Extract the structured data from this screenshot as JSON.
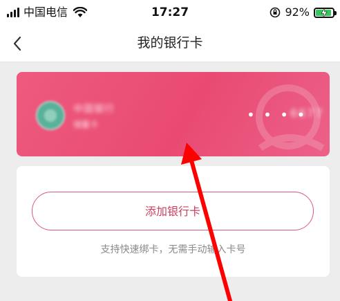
{
  "status_bar": {
    "carrier": "中国电信",
    "time": "17:27",
    "battery_percent": "92%",
    "battery_level": 0.92,
    "icons": [
      "signal-icon",
      "wifi-icon",
      "rotation-lock-icon",
      "battery-charging-icon"
    ]
  },
  "nav": {
    "title": "我的银行卡",
    "back_icon": "chevron-left-icon"
  },
  "card": {
    "bank_name": "中国银行",
    "card_type": "储蓄卡",
    "masked_dots": "• • • •",
    "last4": "6677",
    "colors": {
      "start": "#ee5a7e",
      "end": "#ec6189"
    }
  },
  "add_card": {
    "button_label": "添加银行卡",
    "hint": "支持快速绑卡，无需手动输入卡号",
    "accent_color": "#cc3e62"
  },
  "annotation": {
    "arrow_color": "#ff0000"
  }
}
